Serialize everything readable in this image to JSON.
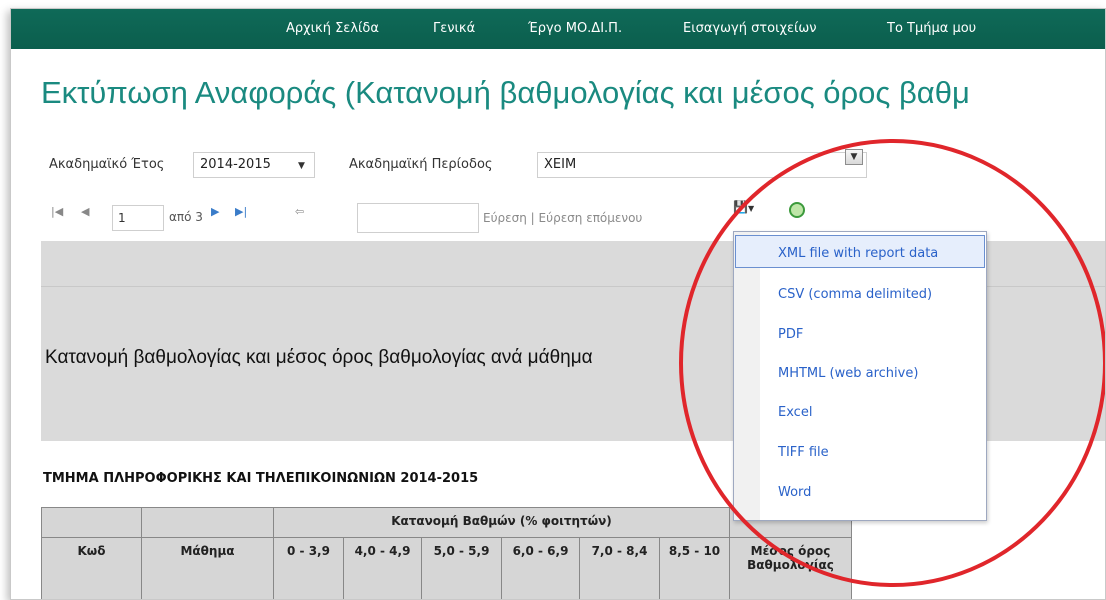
{
  "nav": {
    "items": [
      "Αρχική Σελίδα",
      "Γενικά",
      "Έργο ΜΟ.ΔΙ.Π.",
      "Εισαγωγή στοιχείων",
      "Το Τμήμα μου"
    ]
  },
  "page": {
    "title": "Εκτύπωση Αναφοράς (Κατανομή βαθμολογίας και μέσος όρος βαθμ"
  },
  "params": {
    "year_label": "Ακαδημαϊκό Έτος",
    "year_value": "2014-2015",
    "period_label": "Ακαδημαϊκή Περίοδος",
    "period_value": "ΧΕΙΜ"
  },
  "toolbar": {
    "page_value": "1",
    "of_text": "από 3",
    "find_label": "Εύρεση",
    "find_sep": "|",
    "find_next_label": "Εύρεση επόμενου"
  },
  "report": {
    "heading": "Κατανομή βαθμολογίας και μέσος όρος βαθμολογίας ανά μάθημα",
    "dept_title": "ΤΜΗΜΑ ΠΛΗΡΟΦΟΡΙΚΗΣ ΚΑΙ ΤΗΛΕΠΙΚΟΙΝΩΝΙΩΝ 2014-2015",
    "table": {
      "group_header": "Κατανομή Βαθμών (% φοιτητών)",
      "col_code": "Κωδ",
      "col_course": "Μάθημα",
      "ranges": [
        "0 - 3,9",
        "4,0 - 4,9",
        "5,0 - 5,9",
        "6,0 - 6,9",
        "7,0 - 8,4",
        "8,5 - 10"
      ],
      "col_avg": "Μέσος όρος Βαθμολογίας"
    }
  },
  "export_menu": {
    "options": [
      "XML file with report data",
      "CSV (comma delimited)",
      "PDF",
      "MHTML (web archive)",
      "Excel",
      "TIFF file",
      "Word"
    ]
  },
  "colors": {
    "nav_bg": "#0b5e4d",
    "title": "#1a8a80",
    "menu_text": "#2a62c9",
    "annotation": "#e0262b"
  }
}
